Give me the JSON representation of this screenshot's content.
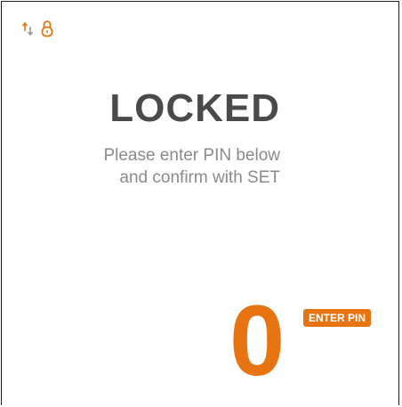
{
  "status_bar": {
    "icons": [
      "transfer-arrows-icon",
      "padlock-icon"
    ]
  },
  "lock_screen": {
    "title": "LOCKED",
    "instruction_line1": "Please enter PIN below",
    "instruction_line2": "and confirm with SET"
  },
  "pin_entry": {
    "current_digit": "0",
    "badge_label": "ENTER PIN"
  },
  "colors": {
    "accent": "#e87311",
    "title": "#4a4a4a",
    "instruction_text": "#8a8a8a",
    "arrow_down_gray": "#9a9a9a"
  }
}
